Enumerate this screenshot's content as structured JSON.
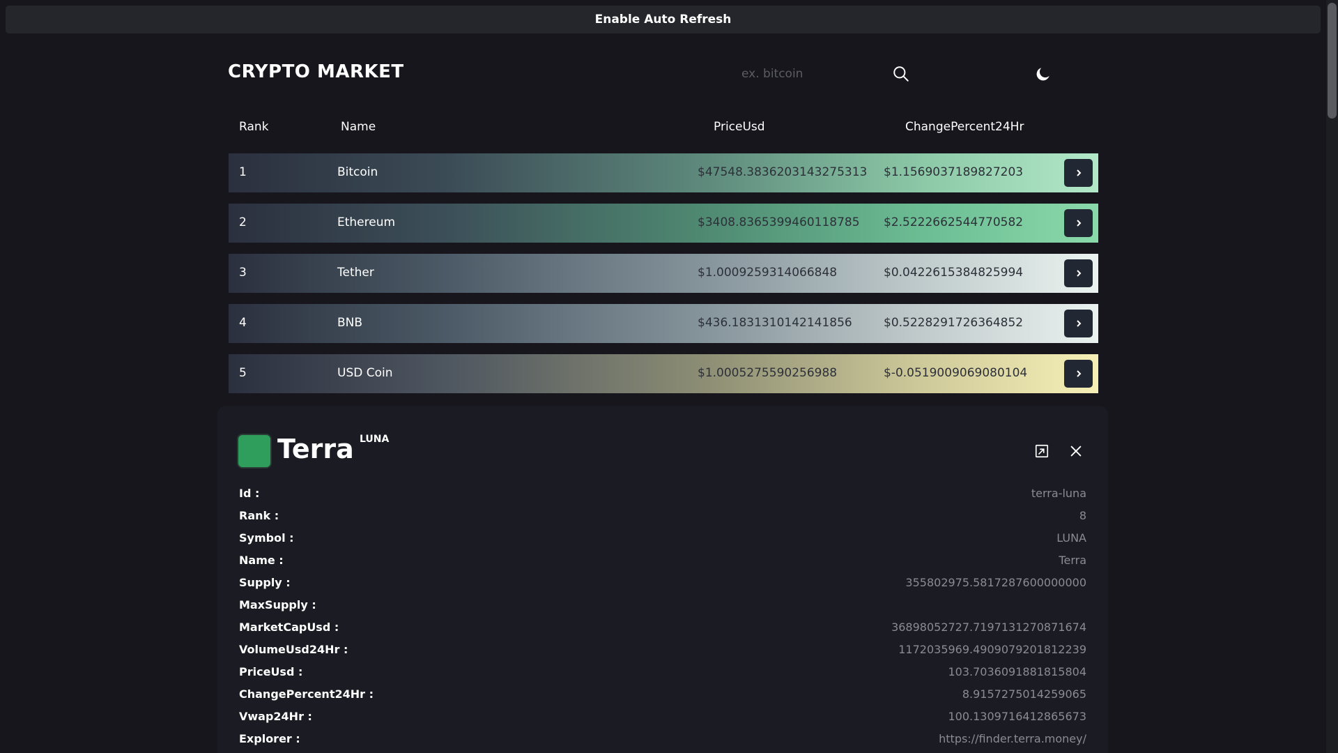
{
  "refresh_bar": {
    "label": "Enable Auto Refresh"
  },
  "header": {
    "title": "CRYPTO MARKET",
    "search_placeholder": "ex. bitcoin"
  },
  "table": {
    "columns": [
      "Rank",
      "Name",
      "PriceUsd",
      "ChangePercent24Hr"
    ],
    "rows": [
      {
        "rank": "1",
        "name": "Bitcoin",
        "price": "$47548.3836203143275313",
        "change": "$1.1569037189827203"
      },
      {
        "rank": "2",
        "name": "Ethereum",
        "price": "$3408.8365399460118785",
        "change": "$2.5222662544770582"
      },
      {
        "rank": "3",
        "name": "Tether",
        "price": "$1.0009259314066848",
        "change": "$0.0422615384825994"
      },
      {
        "rank": "4",
        "name": "BNB",
        "price": "$436.1831310142141856",
        "change": "$0.5228291726364852"
      },
      {
        "rank": "5",
        "name": "USD Coin",
        "price": "$1.0005275590256988",
        "change": "$-0.0519009069080104"
      }
    ],
    "row_arrow": "›"
  },
  "details": {
    "name": "Terra",
    "symbol": "LUNA",
    "fields": [
      {
        "label": "Id :",
        "value": "terra-luna"
      },
      {
        "label": "Rank :",
        "value": "8"
      },
      {
        "label": "Symbol :",
        "value": "LUNA"
      },
      {
        "label": "Name :",
        "value": "Terra"
      },
      {
        "label": "Supply :",
        "value": "355802975.5817287600000000"
      },
      {
        "label": "MaxSupply :",
        "value": ""
      },
      {
        "label": "MarketCapUsd :",
        "value": "36898052727.7197131270871674"
      },
      {
        "label": "VolumeUsd24Hr :",
        "value": "1172035969.4909079201812239"
      },
      {
        "label": "PriceUsd :",
        "value": "103.7036091881815804"
      },
      {
        "label": "ChangePercent24Hr :",
        "value": "8.9157275014259065"
      },
      {
        "label": "Vwap24Hr :",
        "value": "100.1309716412865673"
      },
      {
        "label": "Explorer :",
        "value": "https://finder.terra.money/"
      }
    ]
  },
  "colors": {
    "background": "#16161c",
    "bar": "#25262b",
    "panel": "#1a1b23",
    "button": "#222833",
    "coin_swatch": "#2f9d5c"
  },
  "icons": [
    "search-icon",
    "moon-icon",
    "chevron-right-icon",
    "open-external-icon",
    "close-icon"
  ]
}
